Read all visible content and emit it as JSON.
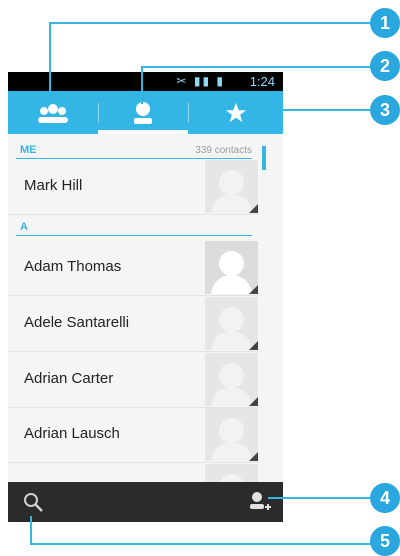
{
  "status_bar": {
    "time": "1:24",
    "icons": "✂ ▮▮ ▮"
  },
  "tabs": [
    {
      "icon": "groups-icon",
      "label": ""
    },
    {
      "icon": "contacts-icon",
      "label": ""
    },
    {
      "icon": "favorites-star-icon",
      "label": ""
    }
  ],
  "sections": {
    "me": {
      "title": "ME",
      "count": "339 contacts"
    },
    "a": {
      "title": "A"
    }
  },
  "contacts": {
    "me": {
      "name": "Mark Hill"
    },
    "list": [
      {
        "name": "Adam Thomas"
      },
      {
        "name": "Adele Santarelli"
      },
      {
        "name": "Adrian Carter"
      },
      {
        "name": "Adrian Lausch"
      }
    ]
  },
  "callouts": [
    "1",
    "2",
    "3",
    "4",
    "5"
  ],
  "colors": {
    "accent": "#33b5e5",
    "badge": "#2aa7de",
    "bottom_bar": "#2b2b2b"
  }
}
